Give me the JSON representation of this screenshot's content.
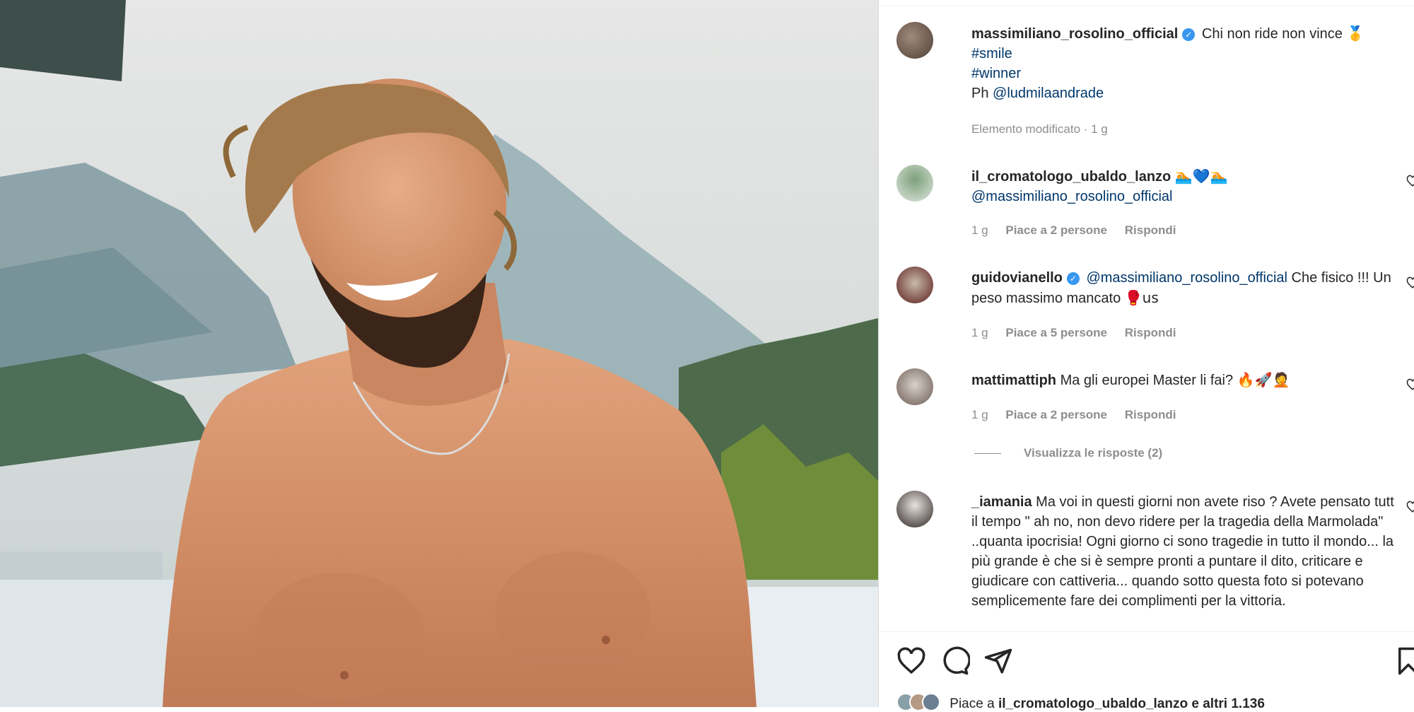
{
  "post": {
    "author": "massimiliano_rosolino_official",
    "caption": "Chi non ride non vince",
    "caption_emoji": "🥇",
    "hashtags": [
      "#smile",
      "#winner"
    ],
    "photo_credit_prefix": "Ph",
    "photo_credit_user": "@ludmilaandrade",
    "edited_label": "Elemento modificato · 1 g"
  },
  "comments": [
    {
      "user": "il_cromatologo_ubaldo_lanzo",
      "verified": false,
      "emoji": "🏊💙🏊",
      "mention": "@massimiliano_rosolino_official",
      "text": "",
      "time": "1 g",
      "likes": "Piace a 2 persone",
      "reply": "Rispondi"
    },
    {
      "user": "guidovianello",
      "verified": true,
      "mention": "@massimiliano_rosolino_official",
      "text": "Che fisico !!! Un peso massimo mancato",
      "emoji": "🥊us",
      "time": "1 g",
      "likes": "Piace a 5 persone",
      "reply": "Rispondi"
    },
    {
      "user": "mattimattiph",
      "verified": false,
      "text": "Ma gli europei Master li fai?",
      "emoji": "🔥🚀🤦",
      "time": "1 g",
      "likes": "Piace a 2 persone",
      "reply": "Rispondi",
      "view_replies": "Visualizza le risposte (2)"
    },
    {
      "user": "_iamania",
      "verified": false,
      "text": "Ma voi in questi giorni non avete riso ? Avete pensato tutt il tempo \" ah no, non devo ridere per la tragedia della Marmolada\" ..quanta ipocrisia! Ogni giorno ci sono tragedie in tutto il mondo... la più grande è che si è sempre pronti a puntare il dito, criticare e giudicare con cattiveria... quando sotto questa foto si potevano semplicemente fare dei complimenti per la vittoria."
    }
  ],
  "likes_line": {
    "prefix": "Piace a",
    "user": "il_cromatologo_ubaldo_lanzo",
    "suffix": "e altri 1.136"
  },
  "icons": [
    "like-icon",
    "comment-icon",
    "share-icon",
    "save-icon",
    "verified-badge-icon"
  ],
  "colors": {
    "verified": "#3897f0",
    "link": "#00376b",
    "meta": "#8e8e8e",
    "text": "#262626"
  }
}
